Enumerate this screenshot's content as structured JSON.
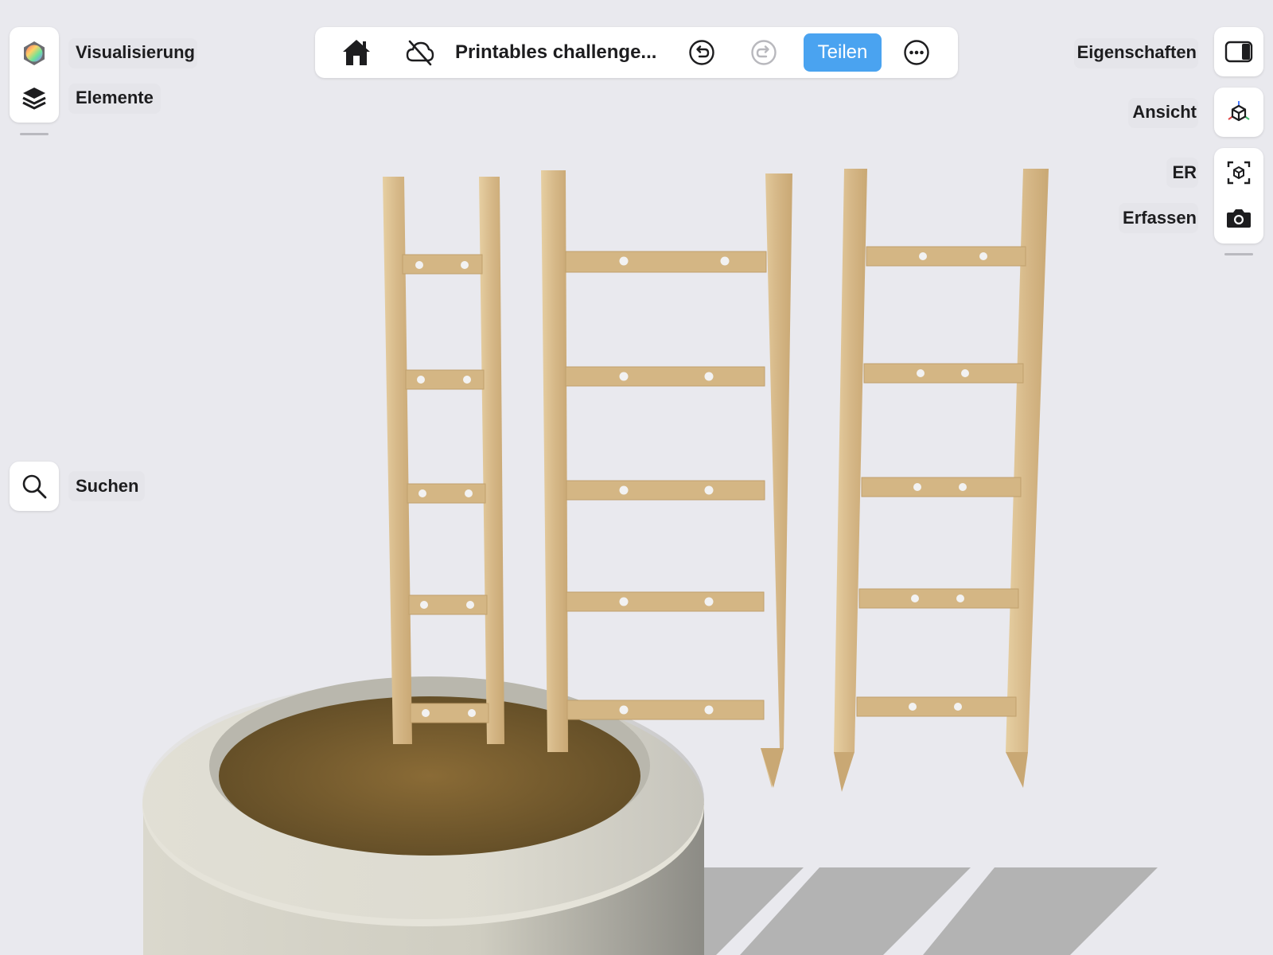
{
  "colors": {
    "accent": "#4aa3f0",
    "background": "#e9e9ee",
    "wood": "#d9bd8e",
    "pot": "#d8d6cb",
    "soil": "#7a6030",
    "shadow": "#b3b3b3"
  },
  "left_panel": {
    "items": [
      {
        "label": "Visualisierung",
        "icon": "color-sphere-icon"
      },
      {
        "label": "Elemente",
        "icon": "layers-icon"
      }
    ],
    "search": {
      "label": "Suchen",
      "icon": "search-icon"
    }
  },
  "toolbar": {
    "title": "Printables challenge...",
    "share_label": "Teilen",
    "icons": [
      "home-icon",
      "cloud-off-icon",
      "undo-icon",
      "redo-icon",
      "more-icon"
    ]
  },
  "right_panel": {
    "items": [
      {
        "label": "Eigenschaften",
        "icon": "sidebar-toggle-icon"
      },
      {
        "label": "Ansicht",
        "icon": "view-cube-icon"
      },
      {
        "label": "ER",
        "icon": "ar-icon"
      },
      {
        "label": "Erfassen",
        "icon": "camera-icon"
      }
    ]
  }
}
